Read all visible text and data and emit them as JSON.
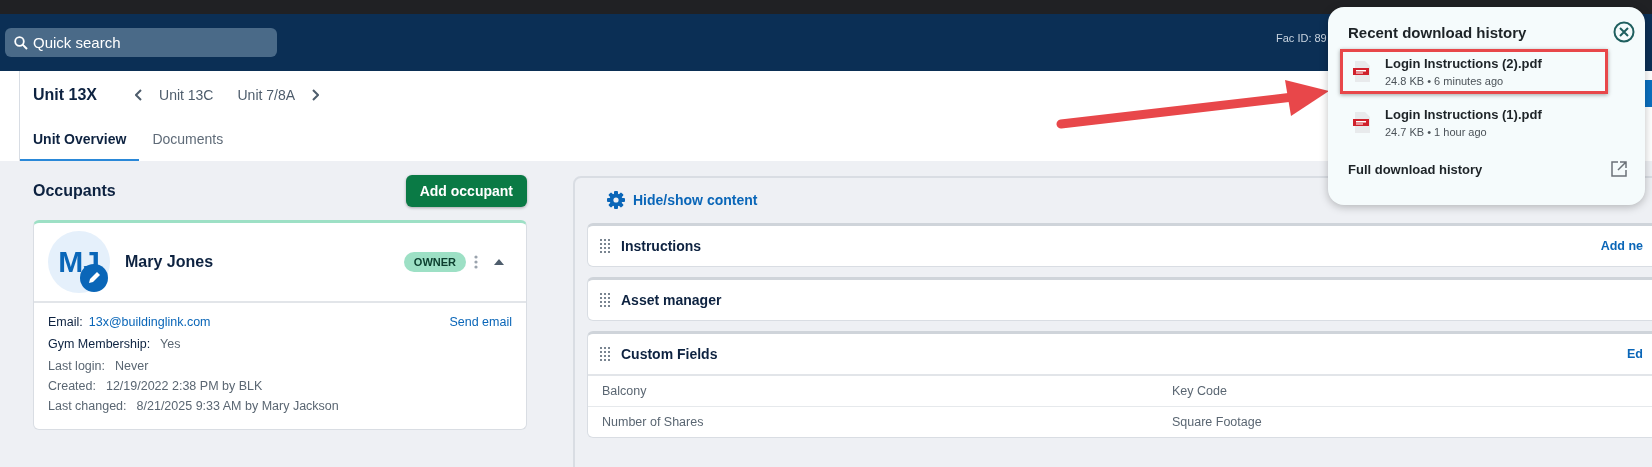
{
  "header": {
    "search": {
      "placeholder": "Quick search"
    },
    "fac_id": "Fac ID: 89"
  },
  "unit": {
    "title": "Unit 13X",
    "prev": "Unit 13C",
    "next": "Unit 7/8A"
  },
  "tabs": [
    {
      "label": "Unit Overview",
      "selected": true
    },
    {
      "label": "Documents",
      "selected": false
    }
  ],
  "occupants": {
    "title": "Occupants",
    "add_button": "Add occupant",
    "cards": [
      {
        "initials": "MJ",
        "name": "Mary Jones",
        "role": "OWNER",
        "expanded": true,
        "email_label": "Email:",
        "email": "13x@buildinglink.com",
        "send_email": "Send email",
        "fields": [
          {
            "kind": "custom",
            "label": "Gym Membership:",
            "value": "Yes"
          },
          {
            "kind": "meta",
            "label": "Last login:",
            "value": "Never"
          },
          {
            "kind": "meta",
            "label": "Created:",
            "value": "12/19/2022 2:38 PM by BLK"
          },
          {
            "kind": "meta",
            "label": "Last changed:",
            "value": "8/21/2025 9:33 AM by Mary Jackson"
          }
        ]
      }
    ]
  },
  "content": {
    "toggle": "Hide/show content",
    "sections": [
      {
        "title": "Instructions",
        "action": "Add ne"
      },
      {
        "title": "Asset manager"
      },
      {
        "title": "Custom Fields",
        "action": "Ed",
        "rows": [
          [
            "Balcony",
            "Key Code"
          ],
          [
            "Number of Shares",
            "Square Footage"
          ]
        ]
      }
    ]
  },
  "downloads": {
    "title": "Recent download history",
    "items": [
      {
        "name": "Login Instructions (2).pdf",
        "meta": "24.8 KB • 6 minutes ago",
        "highlighted": true
      },
      {
        "name": "Login Instructions (1).pdf",
        "meta": "24.7 KB • 1 hour ago",
        "highlighted": false
      }
    ],
    "footer": "Full download history"
  }
}
